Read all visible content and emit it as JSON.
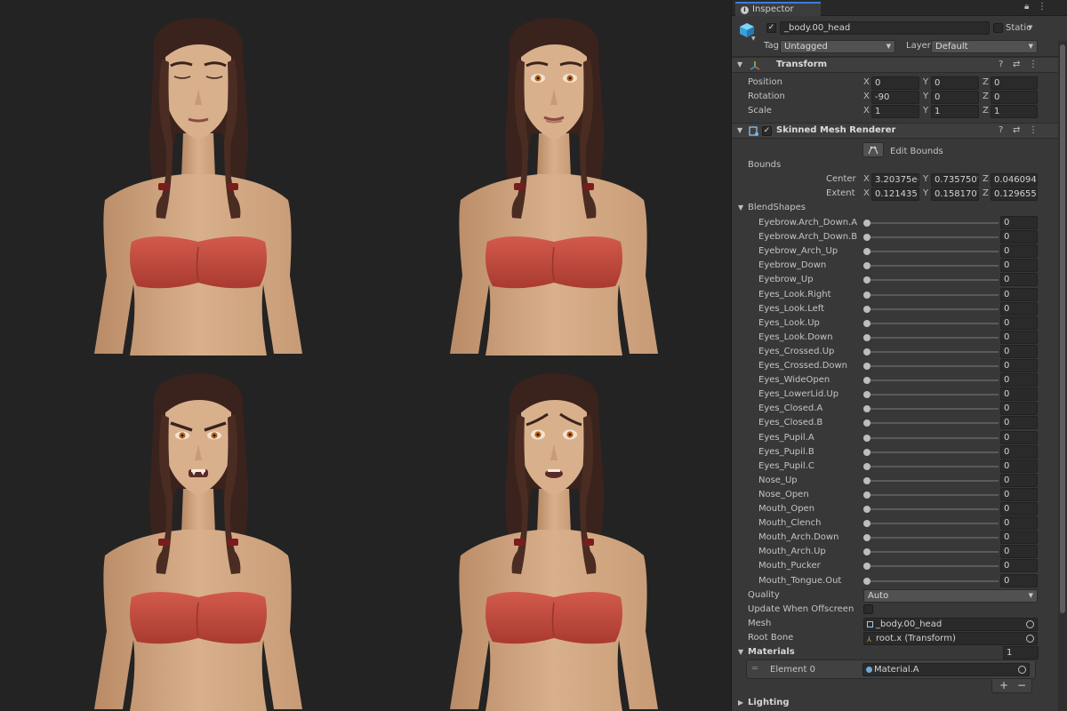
{
  "inspector": {
    "tab_label": "Inspector",
    "object_name": "_body.00_head",
    "static_label": "Static",
    "tag_label": "Tag",
    "tag_value": "Untagged",
    "layer_label": "Layer",
    "layer_value": "Default"
  },
  "transform": {
    "title": "Transform",
    "position_label": "Position",
    "rotation_label": "Rotation",
    "scale_label": "Scale",
    "position": {
      "x": "0",
      "y": "0",
      "z": "0"
    },
    "rotation": {
      "x": "-90",
      "y": "0",
      "z": "0"
    },
    "scale": {
      "x": "1",
      "y": "1",
      "z": "1"
    }
  },
  "renderer": {
    "title": "Skinned Mesh Renderer",
    "edit_bounds_label": "Edit Bounds",
    "bounds_label": "Bounds",
    "center_label": "Center",
    "extent_label": "Extent",
    "center": {
      "x": "3.20375e-",
      "y": "0.735750'",
      "z": "0.046094"
    },
    "extent": {
      "x": "0.121435",
      "y": "0.1581707",
      "z": "0.1296553"
    },
    "blendshapes_label": "BlendShapes",
    "blendshapes": [
      {
        "name": "Eyebrow.Arch_Down.A",
        "value": "0"
      },
      {
        "name": "Eyebrow.Arch_Down.B",
        "value": "0"
      },
      {
        "name": "Eyebrow_Arch_Up",
        "value": "0"
      },
      {
        "name": "Eyebrow_Down",
        "value": "0"
      },
      {
        "name": "Eyebrow_Up",
        "value": "0"
      },
      {
        "name": "Eyes_Look.Right",
        "value": "0"
      },
      {
        "name": "Eyes_Look.Left",
        "value": "0"
      },
      {
        "name": "Eyes_Look.Up",
        "value": "0"
      },
      {
        "name": "Eyes_Look.Down",
        "value": "0"
      },
      {
        "name": "Eyes_Crossed.Up",
        "value": "0"
      },
      {
        "name": "Eyes_Crossed.Down",
        "value": "0"
      },
      {
        "name": "Eyes_WideOpen",
        "value": "0"
      },
      {
        "name": "Eyes_LowerLid.Up",
        "value": "0"
      },
      {
        "name": "Eyes_Closed.A",
        "value": "0"
      },
      {
        "name": "Eyes_Closed.B",
        "value": "0"
      },
      {
        "name": "Eyes_Pupil.A",
        "value": "0"
      },
      {
        "name": "Eyes_Pupil.B",
        "value": "0"
      },
      {
        "name": "Eyes_Pupil.C",
        "value": "0"
      },
      {
        "name": "Nose_Up",
        "value": "0"
      },
      {
        "name": "Nose_Open",
        "value": "0"
      },
      {
        "name": "Mouth_Open",
        "value": "0"
      },
      {
        "name": "Mouth_Clench",
        "value": "0"
      },
      {
        "name": "Mouth_Arch.Down",
        "value": "0"
      },
      {
        "name": "Mouth_Arch.Up",
        "value": "0"
      },
      {
        "name": "Mouth_Pucker",
        "value": "0"
      },
      {
        "name": "Mouth_Tongue.Out",
        "value": "0"
      }
    ],
    "quality_label": "Quality",
    "quality_value": "Auto",
    "update_offscreen_label": "Update When Offscreen",
    "mesh_label": "Mesh",
    "mesh_value": "_body.00_head",
    "root_bone_label": "Root Bone",
    "root_bone_value": "root.x (Transform)",
    "materials_label": "Materials",
    "materials_count": "1",
    "element_label": "Element 0",
    "element_value": "Material.A",
    "add_label": "+",
    "remove_label": "−",
    "lighting_label": "Lighting"
  },
  "colors": {
    "accent": "#3b7ddd",
    "skin": "#d9b08c",
    "hair": "#3a231c",
    "top": "#c4493c",
    "eye": "#b8651e"
  }
}
